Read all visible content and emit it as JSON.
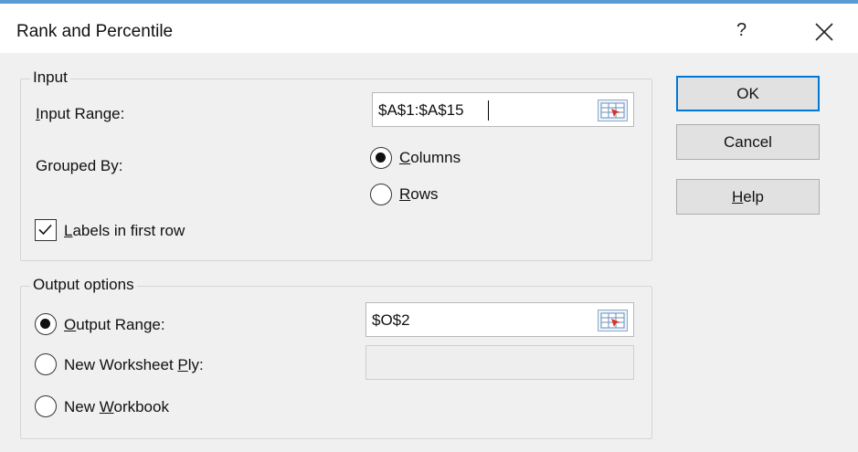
{
  "dialog": {
    "title": "Rank and Percentile",
    "help_glyph": "?"
  },
  "input_group": {
    "legend": "Input",
    "input_range_prefix": "I",
    "input_range_rest": "nput Range:",
    "input_range_value": "$A$1:$A$15",
    "grouped_by_label": "Grouped By:",
    "columns_ul": "C",
    "columns_rest": "olumns",
    "columns_checked": true,
    "rows_ul": "R",
    "rows_rest": "ows",
    "rows_checked": false,
    "labels_ul": "L",
    "labels_rest": "abels in first row",
    "labels_checked": true
  },
  "output_group": {
    "legend": "Output options",
    "output_range_ul": "O",
    "output_range_rest": "utput Range:",
    "output_range_checked": true,
    "output_range_value": "$O$2",
    "new_ply_pre": "New Worksheet ",
    "new_ply_ul": "P",
    "new_ply_rest": "ly:",
    "new_ply_checked": false,
    "new_ply_value": "",
    "new_workbook_pre": "New ",
    "new_workbook_ul": "W",
    "new_workbook_rest": "orkbook",
    "new_workbook_checked": false
  },
  "buttons": {
    "ok": "OK",
    "cancel": "Cancel",
    "help_ul": "H",
    "help_rest": "elp"
  },
  "colors": {
    "accent": "#0078d7",
    "title_strip": "#5b9bd5",
    "dialog_bg": "#f0f0f0"
  },
  "icons": {
    "close": "close-icon",
    "range_selector": "range-selector-icon"
  }
}
